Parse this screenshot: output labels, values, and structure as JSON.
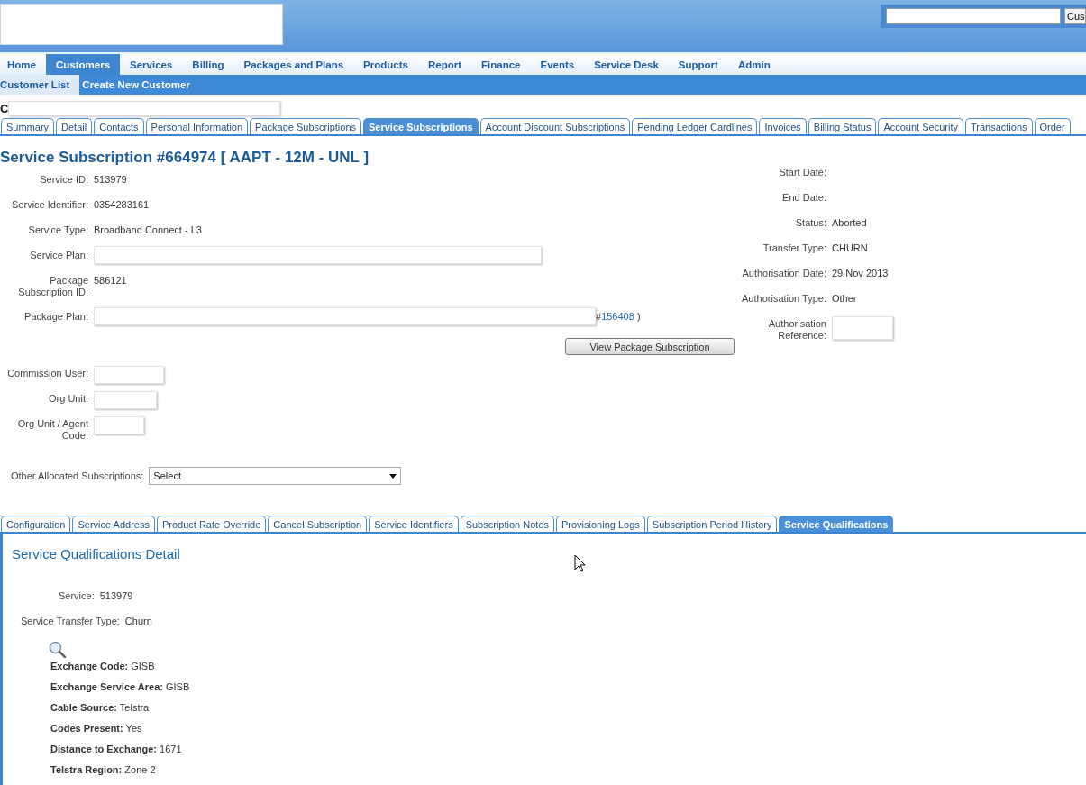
{
  "header": {
    "search_button": "Cus"
  },
  "nav": [
    {
      "label": "Home",
      "selected": false
    },
    {
      "label": "Customers",
      "selected": true
    },
    {
      "label": "Services",
      "selected": false
    },
    {
      "label": "Billing",
      "selected": false
    },
    {
      "label": "Packages and Plans",
      "selected": false
    },
    {
      "label": "Products",
      "selected": false
    },
    {
      "label": "Report",
      "selected": false
    },
    {
      "label": "Finance",
      "selected": false
    },
    {
      "label": "Events",
      "selected": false
    },
    {
      "label": "Service Desk",
      "selected": false
    },
    {
      "label": "Support",
      "selected": false
    },
    {
      "label": "Admin",
      "selected": false
    }
  ],
  "subnav": [
    {
      "label": "Customer List",
      "selected": true
    },
    {
      "label": "Create New Customer",
      "selected": false
    }
  ],
  "customer": {
    "label": "C"
  },
  "tabs": [
    {
      "label": "Summary",
      "selected": false
    },
    {
      "label": "Detail",
      "selected": false
    },
    {
      "label": "Contacts",
      "selected": false
    },
    {
      "label": "Personal Information",
      "selected": false
    },
    {
      "label": "Package Subscriptions",
      "selected": false
    },
    {
      "label": "Service Subscriptions",
      "selected": true
    },
    {
      "label": "Account Discount Subscriptions",
      "selected": false
    },
    {
      "label": "Pending Ledger Cardlines",
      "selected": false
    },
    {
      "label": "Invoices",
      "selected": false
    },
    {
      "label": "Billing Status",
      "selected": false
    },
    {
      "label": "Account Security",
      "selected": false
    },
    {
      "label": "Transactions",
      "selected": false
    },
    {
      "label": "Order",
      "selected": false
    }
  ],
  "subscription": {
    "title": "Service Subscription #664974 [ AAPT - 12M - UNL ]",
    "left_fields": [
      {
        "kind": "text",
        "label": "Service ID:",
        "value": "513979"
      },
      {
        "kind": "text",
        "label": "Service Identifier:",
        "value": "0354283161"
      },
      {
        "kind": "text",
        "label": "Service Type:",
        "value": "Broadband Connect - L3"
      },
      {
        "kind": "field",
        "label": "Service Plan:"
      },
      {
        "kind": "text",
        "label": "Package Subscription ID:",
        "value": "586121"
      },
      {
        "kind": "plan",
        "label": "Package Plan:",
        "prefix": "#",
        "link": "156408",
        "suffix": ")"
      }
    ],
    "view_button": "View Package Subscription",
    "agent_fields": [
      {
        "label": "Commission User:"
      },
      {
        "label": "Org Unit:"
      },
      {
        "label": "Org Unit / Agent Code:"
      }
    ],
    "allocated": {
      "label": "Other Allocated Subscriptions:",
      "value": "Select"
    },
    "right_fields": [
      {
        "kind": "text",
        "label": "Start Date:"
      },
      {
        "kind": "text",
        "label": "End Date:"
      },
      {
        "kind": "text",
        "label": "Status:",
        "value": "Aborted"
      },
      {
        "kind": "text",
        "label": "Transfer Type:",
        "value": "CHURN"
      },
      {
        "kind": "text",
        "label": "Authorisation Date:",
        "value": "29 Nov 2013"
      },
      {
        "kind": "text",
        "label": "Authorisation Type:",
        "value": "Other"
      },
      {
        "kind": "redacted",
        "label": "Authorisation Reference:"
      }
    ]
  },
  "lower_tabs": [
    {
      "label": "Configuration",
      "selected": false
    },
    {
      "label": "Service Address",
      "selected": false
    },
    {
      "label": "Product Rate Override",
      "selected": false
    },
    {
      "label": "Cancel Subscription",
      "selected": false
    },
    {
      "label": "Service Identifiers",
      "selected": false
    },
    {
      "label": "Subscription Notes",
      "selected": false
    },
    {
      "label": "Provisioning Logs",
      "selected": false
    },
    {
      "label": "Subscription Period History",
      "selected": false
    },
    {
      "label": "Service Qualifications",
      "selected": true
    }
  ],
  "qualification": {
    "title": "Service Qualifications Detail",
    "fields": [
      {
        "label": "Service:",
        "value": "513979"
      },
      {
        "label": "Service Transfer Type:",
        "value": "Churn"
      }
    ],
    "details": [
      {
        "label": "Exchange Code:",
        "value": "GISB"
      },
      {
        "label": "Exchange Service Area:",
        "value": "GISB"
      },
      {
        "label": "Cable Source:",
        "value": "Telstra"
      },
      {
        "label": "Codes Present:",
        "value": "Yes"
      },
      {
        "label": "Distance to Exchange:",
        "value": "1671"
      },
      {
        "label": "Telstra Region:",
        "value": "Zone 2"
      }
    ]
  }
}
